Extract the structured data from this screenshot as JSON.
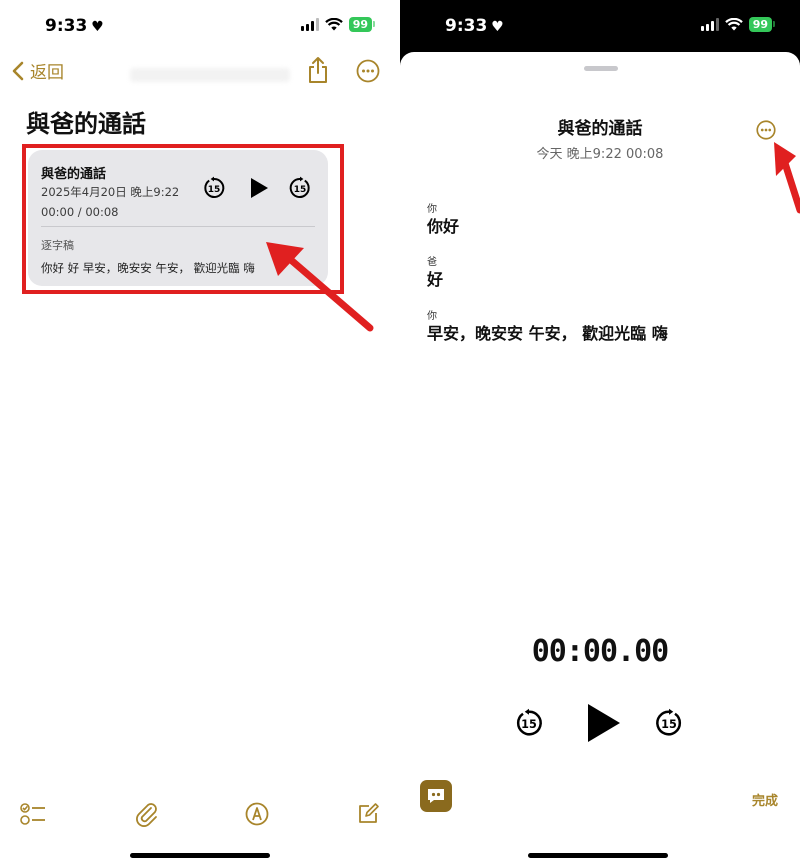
{
  "status_bar": {
    "time": "9:33",
    "battery": "99"
  },
  "left_screen": {
    "nav": {
      "back_label": "返回"
    },
    "note_title": "與爸的通話",
    "recording_card": {
      "title": "與爸的通話",
      "date": "2025年4月20日 晚上9:22",
      "duration": "00:00 / 00:08",
      "transcript_label": "逐字稿",
      "transcript_preview": "你好 好 早安，晚安安 午安，  歡迎光臨 嗨"
    },
    "toolbar": [
      "checklist-icon",
      "attachment-icon",
      "markup-icon",
      "compose-icon"
    ]
  },
  "right_screen": {
    "sheet": {
      "title": "與爸的通話",
      "subtitle": "今天 晚上9:22  00:08",
      "transcript": [
        {
          "speaker": "你",
          "text": "你好"
        },
        {
          "speaker": "爸",
          "text": "好"
        },
        {
          "speaker": "你",
          "text": "早安，晚安安 午安，  歡迎光臨 嗨"
        }
      ],
      "timer": "00:00.00",
      "done_label": "完成"
    }
  },
  "colors": {
    "accent": "#a8852b",
    "highlight": "#e02020",
    "card_bg": "#e7e7ea",
    "battery": "#34c759"
  }
}
